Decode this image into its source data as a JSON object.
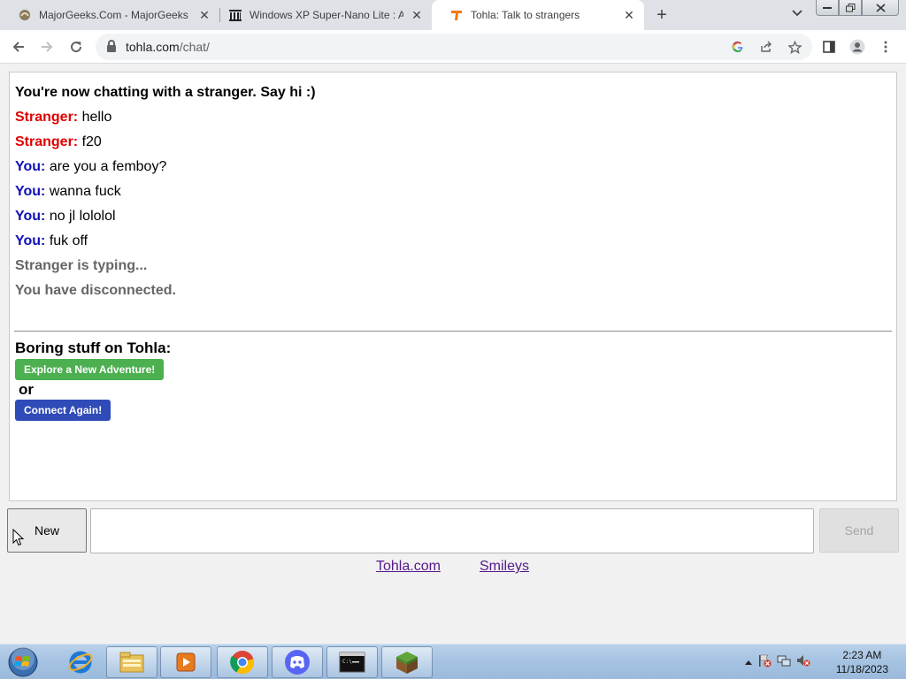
{
  "browser": {
    "tabs": [
      {
        "title": "MajorGeeks.Com - MajorGeeks",
        "icon": "majorgeeks-icon"
      },
      {
        "title": "Windows XP Super-Nano Lite : A",
        "icon": "archive-icon"
      },
      {
        "title": "Tohla: Talk to strangers",
        "icon": "tohla-icon",
        "active": true
      }
    ],
    "url_host": "tohla.com",
    "url_path": "/chat/",
    "window_controls": [
      "minimize",
      "restore",
      "close"
    ]
  },
  "chat": {
    "messages": [
      {
        "type": "status",
        "text": "You're now chatting with a stranger. Say hi :)"
      },
      {
        "type": "stranger",
        "speaker": "Stranger:",
        "text": "hello"
      },
      {
        "type": "stranger",
        "speaker": "Stranger:",
        "text": "f20"
      },
      {
        "type": "you",
        "speaker": "You:",
        "text": "are you a femboy?"
      },
      {
        "type": "you",
        "speaker": "You:",
        "text": "wanna fuck"
      },
      {
        "type": "you",
        "speaker": "You:",
        "text": "no jl lololol"
      },
      {
        "type": "you",
        "speaker": "You:",
        "text": "fuk off"
      },
      {
        "type": "info",
        "text": "Stranger is typing..."
      },
      {
        "type": "info",
        "text": "You have disconnected."
      }
    ],
    "boring_heading": "Boring stuff on Tohla:",
    "explore_button": "Explore a New Adventure!",
    "or_text": "or",
    "connect_button": "Connect Again!"
  },
  "controls": {
    "new_button": "New",
    "message_input_value": "",
    "send_button": "Send"
  },
  "footer": {
    "links": [
      "Tohla.com",
      "Smileys"
    ]
  },
  "taskbar": {
    "apps": [
      "internet-explorer-icon",
      "file-explorer-icon",
      "media-player-icon",
      "chrome-icon",
      "discord-icon",
      "command-prompt-icon",
      "minecraft-icon"
    ],
    "time": "2:23 AM",
    "date": "11/18/2023"
  },
  "colors": {
    "stranger": "#e00000",
    "you": "#1010b8",
    "explore_button": "#4caf50",
    "connect_button": "#2f4bb8",
    "link": "#551a8b"
  }
}
